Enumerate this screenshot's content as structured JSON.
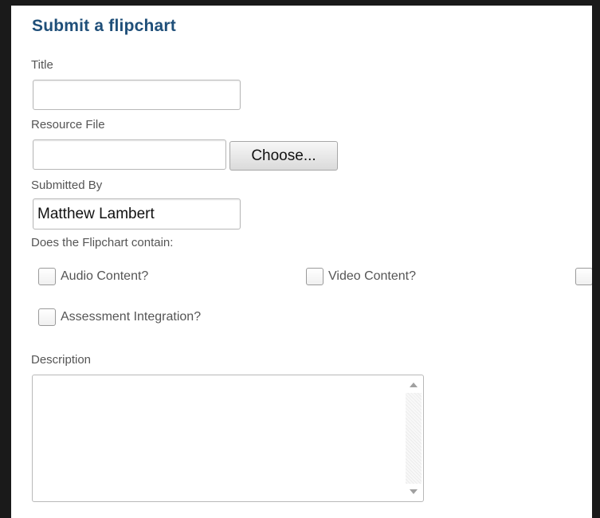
{
  "form": {
    "heading": "Submit a flipchart",
    "title_label": "Title",
    "title_value": "",
    "resource_label": "Resource File",
    "resource_value": "",
    "choose_label": "Choose...",
    "submitted_by_label": "Submitted By",
    "submitted_by_value": "Matthew Lambert",
    "contains_label": "Does the Flipchart contain:",
    "checkboxes": [
      {
        "label": "Audio Content?",
        "checked": false
      },
      {
        "label": "Video Content?",
        "checked": false
      },
      {
        "label": "",
        "checked": false
      },
      {
        "label": "Assessment Integration?",
        "checked": false
      }
    ],
    "description_label": "Description",
    "description_value": ""
  },
  "colors": {
    "heading": "#1f4f79",
    "frame": "#1a1a1a"
  },
  "icons": {
    "scroll_up": "scroll-up-arrow-icon",
    "scroll_down": "scroll-down-arrow-icon"
  }
}
